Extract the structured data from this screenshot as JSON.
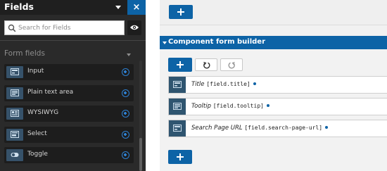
{
  "fields_panel": {
    "title": "Fields",
    "close_label": "×",
    "search": {
      "placeholder": "Search for Fields",
      "value": ""
    },
    "section_title": "Form fields",
    "items": [
      {
        "label": "Input",
        "icon": "input-field-icon"
      },
      {
        "label": "Plain text area",
        "icon": "text-area-icon"
      },
      {
        "label": "WYSIWYG",
        "icon": "wysiwyg-icon"
      },
      {
        "label": "Select",
        "icon": "select-icon"
      },
      {
        "label": "Toggle",
        "icon": "toggle-icon"
      }
    ]
  },
  "builder": {
    "title": "Component form builder",
    "components": [
      {
        "name": "Title",
        "code": "[field.title]"
      },
      {
        "name": "Tooltip",
        "code": "[field.tooltip]"
      },
      {
        "name": "Search Page URL",
        "code": "[field.search-page-url]"
      }
    ]
  },
  "colors": {
    "accent": "#0d63a6",
    "panel_bg": "#2a2a2a",
    "item_bg": "#1d1d1d"
  }
}
